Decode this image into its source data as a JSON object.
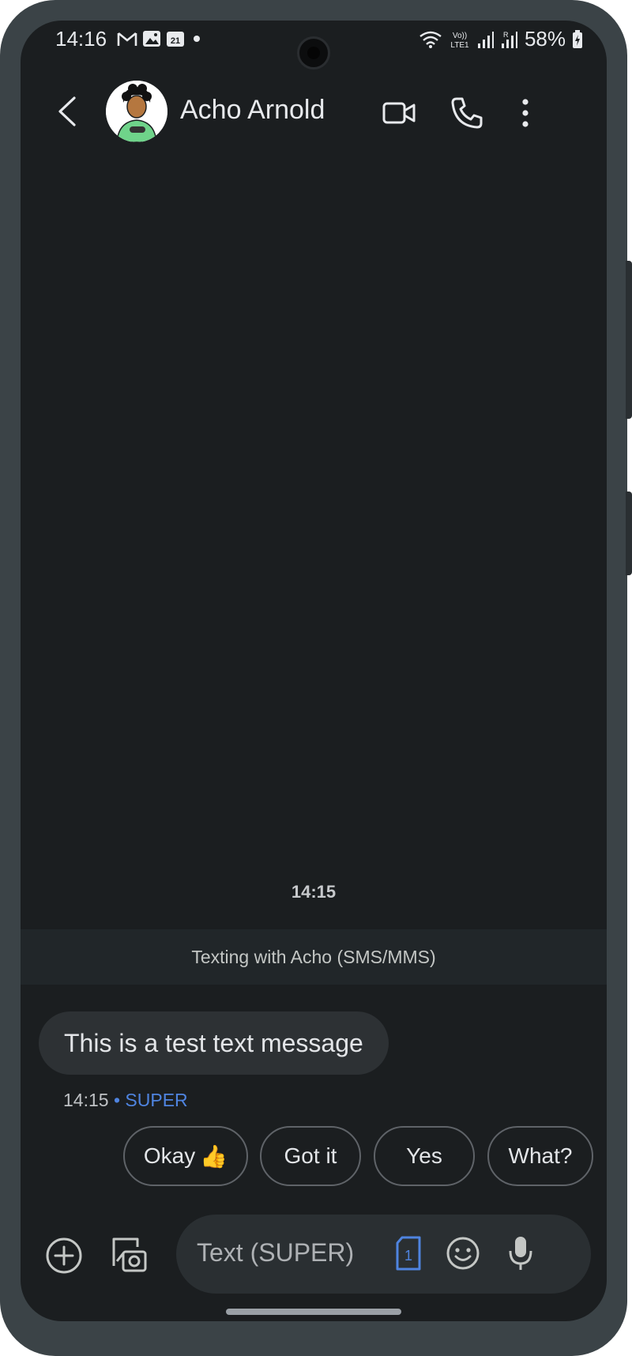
{
  "status_bar": {
    "time": "14:16",
    "battery": "58%"
  },
  "header": {
    "contact_name": "Acho Arnold"
  },
  "conversation": {
    "timestamp_separator": "14:15",
    "banner": "Texting with Acho (SMS/MMS)",
    "message": {
      "text": "This is a test text message",
      "time": "14:15",
      "separator": " • ",
      "sim": "SUPER"
    }
  },
  "smart_replies": [
    {
      "label": "Okay",
      "emoji": "👍"
    },
    {
      "label": "Got it"
    },
    {
      "label": "Yes"
    },
    {
      "label": "What?"
    }
  ],
  "compose": {
    "placeholder": "Text (SUPER)",
    "sim_slot": "1"
  },
  "colors": {
    "background": "#1b1e20",
    "accent": "#4f84e0",
    "bubble": "#2d3134"
  }
}
